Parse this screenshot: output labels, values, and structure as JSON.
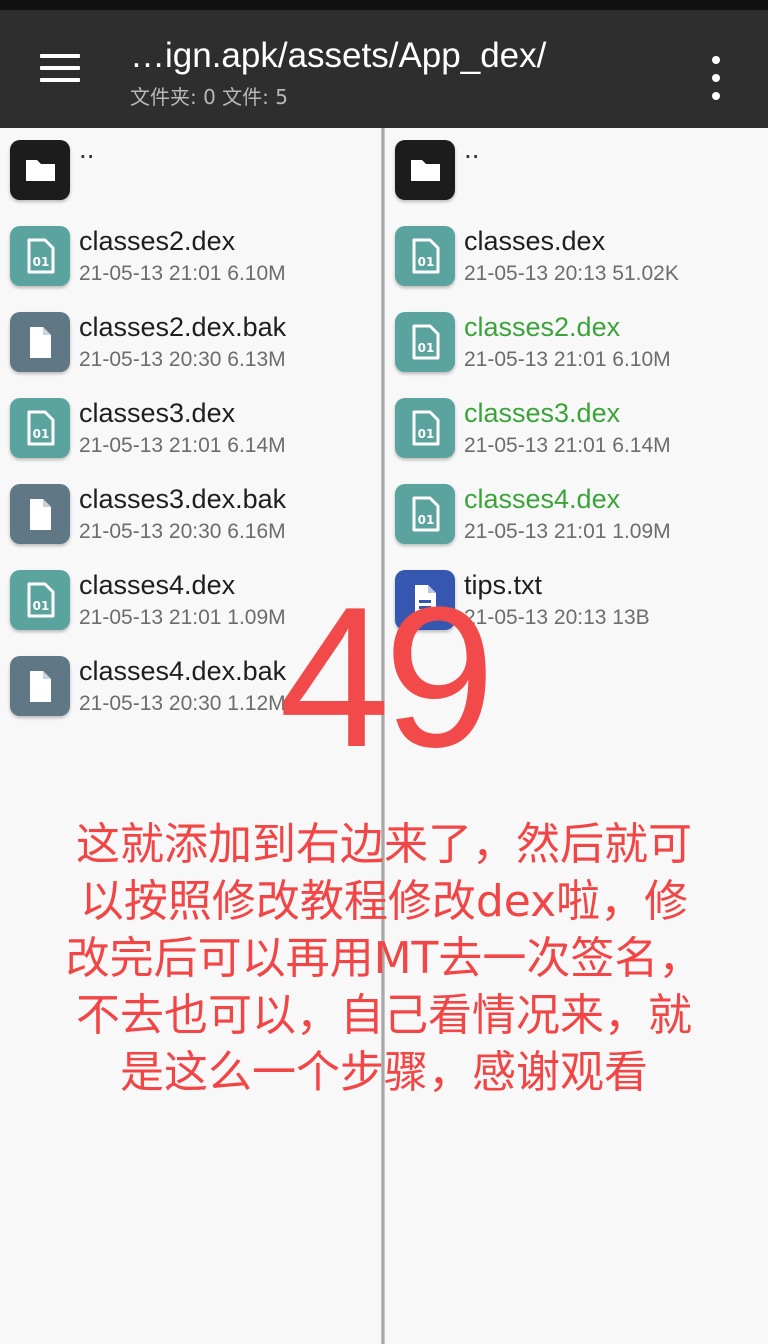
{
  "toolbar": {
    "path": "…ign.apk/assets/App_dex/",
    "subtitle": "文件夹: 0  文件: 5",
    "menu_icon": "hamburger-menu-icon",
    "more_icon": "more-vertical-icon"
  },
  "colors": {
    "toolbar_bg": "#2e2e2e",
    "dex_icon": "#5aa39f",
    "bak_icon": "#607886",
    "folder_icon": "#1c1c1c",
    "txt_icon": "#3557b0",
    "highlight_green": "#3aa43a",
    "overlay_red": "#f24545"
  },
  "left_pane": {
    "parent": "..",
    "files": [
      {
        "name": "classes2.dex",
        "meta": "21-05-13 21:01  6.10M",
        "icon": "dex-file-icon"
      },
      {
        "name": "classes2.dex.bak",
        "meta": "21-05-13 20:30  6.13M",
        "icon": "file-icon"
      },
      {
        "name": "classes3.dex",
        "meta": "21-05-13 21:01  6.14M",
        "icon": "dex-file-icon"
      },
      {
        "name": "classes3.dex.bak",
        "meta": "21-05-13 20:30  6.16M",
        "icon": "file-icon"
      },
      {
        "name": "classes4.dex",
        "meta": "21-05-13 21:01  1.09M",
        "icon": "dex-file-icon"
      },
      {
        "name": "classes4.dex.bak",
        "meta": "21-05-13 20:30  1.12M",
        "icon": "file-icon"
      }
    ]
  },
  "right_pane": {
    "parent": "..",
    "files": [
      {
        "name": "classes.dex",
        "meta": "21-05-13 20:13  51.02K",
        "icon": "dex-file-icon"
      },
      {
        "name": "classes2.dex",
        "meta": "21-05-13 21:01  6.10M",
        "icon": "dex-file-icon"
      },
      {
        "name": "classes3.dex",
        "meta": "21-05-13 21:01  6.14M",
        "icon": "dex-file-icon"
      },
      {
        "name": "classes4.dex",
        "meta": "21-05-13 21:01  1.09M",
        "icon": "dex-file-icon"
      },
      {
        "name": "tips.txt",
        "meta": "21-05-13 20:13  13B",
        "icon": "text-file-icon"
      }
    ]
  },
  "overlay": {
    "number": "49",
    "lines": [
      "这就添加到右边来了，然后就可",
      "以按照修改教程修改dex啦，修",
      "改完后可以再用MT去一次签名，",
      "不去也可以，自己看情况来，就",
      "是这么一个步骤，感谢观看"
    ]
  }
}
